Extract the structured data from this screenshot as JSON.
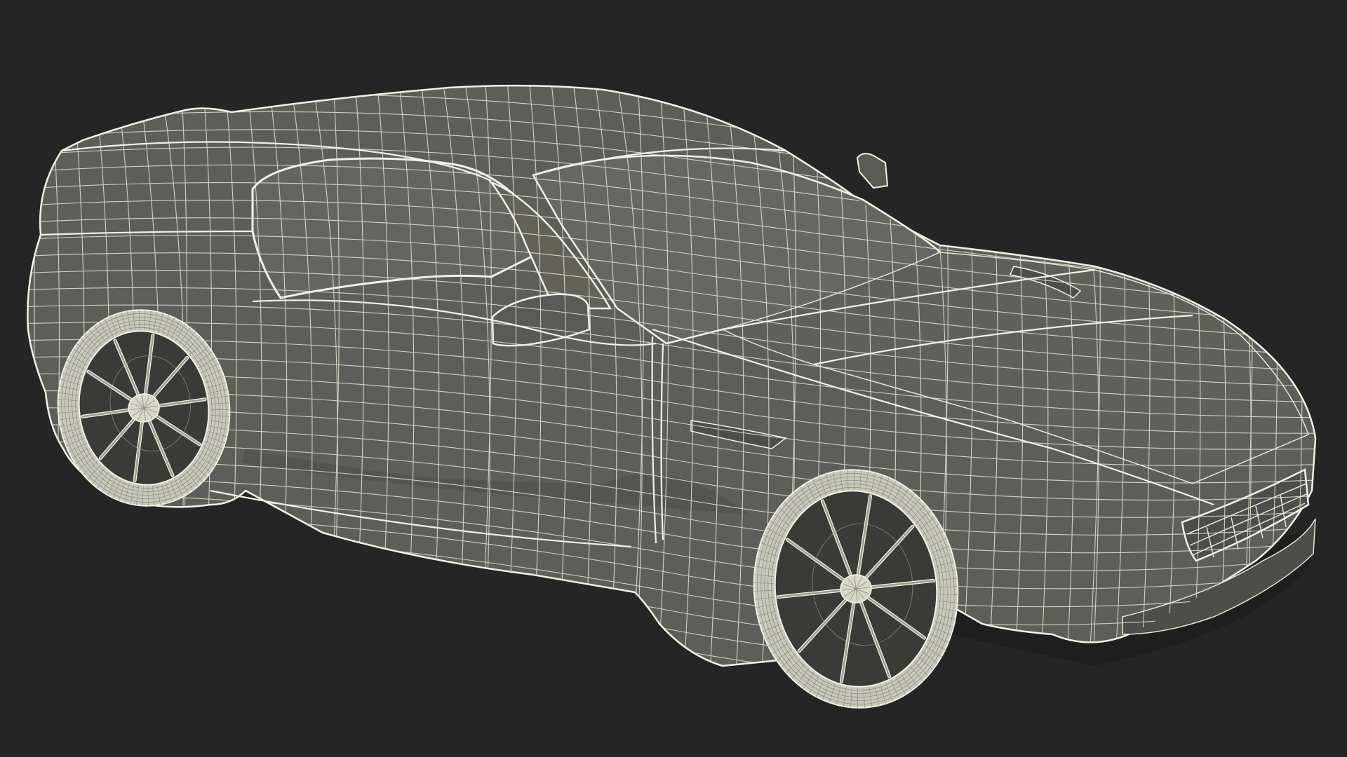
{
  "scene": {
    "background": "#252525",
    "body_fill": "#5e5e59",
    "body_dark": "#4d4d49",
    "glass_fill": "#65655f",
    "wire_color": "#e6e6d6",
    "wire_bright": "#f2f2e4",
    "tire_fill": "#c9c9bb",
    "rim_dark": "#3a3a37"
  },
  "objects": [
    "car-body",
    "rear-wheel",
    "front-wheel",
    "side-mirror",
    "front-grille",
    "roof-antenna"
  ]
}
